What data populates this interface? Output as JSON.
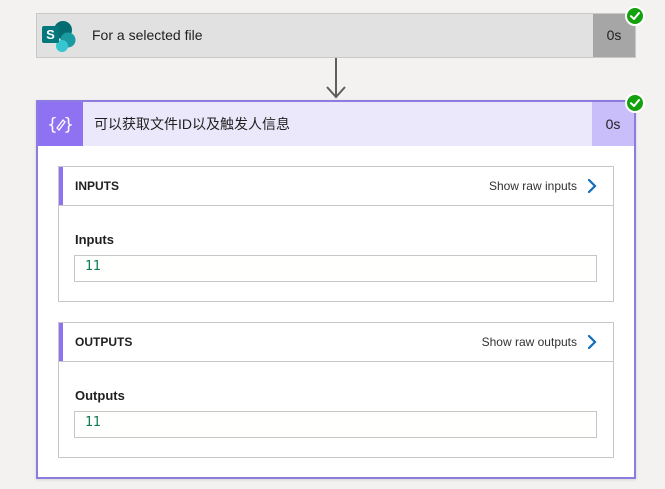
{
  "trigger": {
    "title": "For a selected file",
    "duration": "0s",
    "icon": "sharepoint-icon",
    "status": "succeeded"
  },
  "action": {
    "title": "可以获取文件ID以及触发人信息",
    "duration": "0s",
    "icon": "compose-icon",
    "status": "succeeded",
    "inputs": {
      "section_label": "INPUTS",
      "raw_link": "Show raw inputs",
      "field_label": "Inputs",
      "value": "11"
    },
    "outputs": {
      "section_label": "OUTPUTS",
      "raw_link": "Show raw outputs",
      "field_label": "Outputs",
      "value": "11"
    }
  },
  "colors": {
    "success": "#13a10e",
    "accent": "#8f72f2",
    "link_chevron": "#0f6cbd"
  }
}
